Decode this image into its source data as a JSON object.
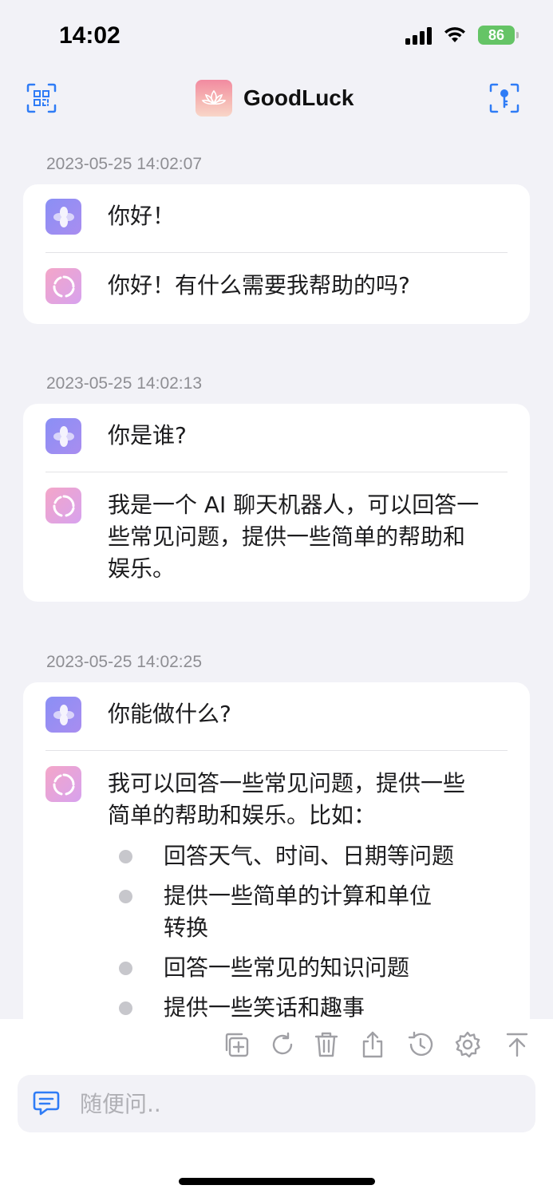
{
  "status_bar": {
    "time": "14:02",
    "battery": "86"
  },
  "nav": {
    "title": "GoodLuck",
    "left_icon": "qr-code-icon",
    "right_icon": "key-icon"
  },
  "conversations": [
    {
      "timestamp": "2023-05-25 14:02:07",
      "user": "你好！",
      "bot": "你好！有什么需要我帮助的吗?"
    },
    {
      "timestamp": "2023-05-25 14:02:13",
      "user": "你是谁?",
      "bot_lines": [
        "我是一个 AI 聊天机器人，可以回答一",
        "些常见问题，提供一些简单的帮助和",
        "娱乐。"
      ]
    },
    {
      "timestamp": "2023-05-25 14:02:25",
      "user": "你能做什么?",
      "bot_lines": [
        "我可以回答一些常见问题，提供一些",
        "简单的帮助和娱乐。比如："
      ],
      "bullets": [
        {
          "lines": [
            "回答天气、时间、日期等问题"
          ]
        },
        {
          "lines": [
            "提供一些简单的计算和单位",
            "转换"
          ]
        },
        {
          "lines": [
            "回答一些常见的知识问题"
          ]
        },
        {
          "lines": [
            "提供一些笑话和趣事"
          ]
        }
      ]
    }
  ],
  "toolbar": {
    "items": [
      "new-chat-icon",
      "refresh-icon",
      "trash-icon",
      "share-icon",
      "history-icon",
      "settings-icon",
      "scroll-top-icon"
    ]
  },
  "input": {
    "placeholder": "随便问.."
  },
  "colors": {
    "accent": "#2f7cf6",
    "background": "#f2f2f7",
    "card": "#ffffff",
    "timestamp": "#8e8e93"
  }
}
